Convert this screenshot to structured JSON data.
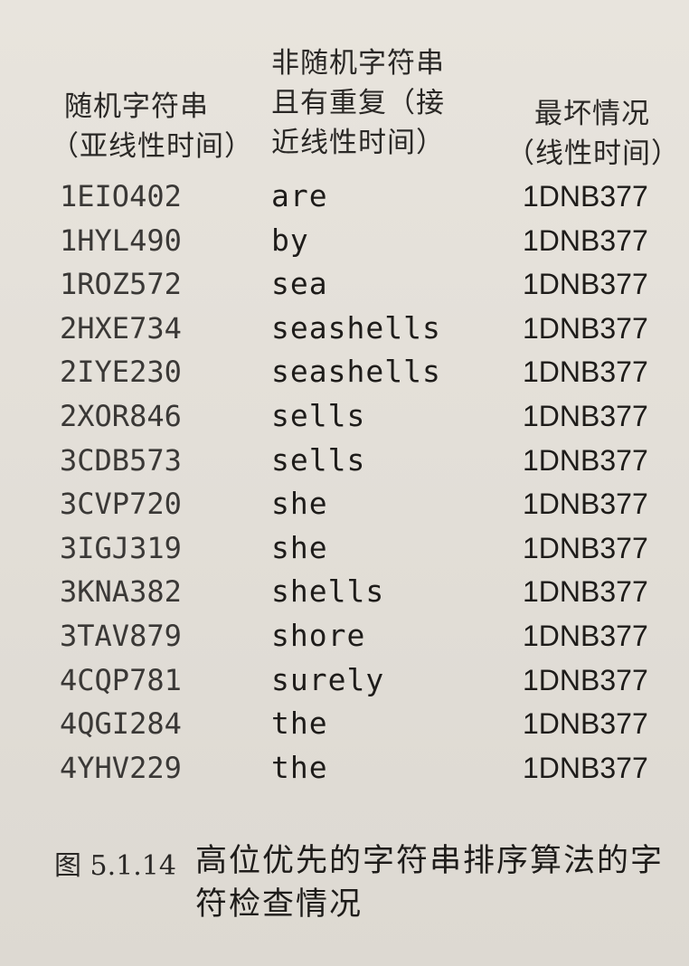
{
  "headers": {
    "col1": [
      "随机字符串",
      "（亚线性时间）"
    ],
    "col2": [
      "非随机字符串",
      "且有重复（接",
      "近线性时间）"
    ],
    "col3": [
      "最坏情况",
      "（线性时间）"
    ]
  },
  "rows": [
    {
      "random": "1EIO402",
      "nonrandom": "are",
      "worst": "1DNB377"
    },
    {
      "random": "1HYL490",
      "nonrandom": "by",
      "worst": "1DNB377"
    },
    {
      "random": "1ROZ572",
      "nonrandom": "sea",
      "worst": "1DNB377"
    },
    {
      "random": "2HXE734",
      "nonrandom": "seashells",
      "worst": "1DNB377"
    },
    {
      "random": "2IYE230",
      "nonrandom": "seashells",
      "worst": "1DNB377"
    },
    {
      "random": "2XOR846",
      "nonrandom": "sells",
      "worst": "1DNB377"
    },
    {
      "random": "3CDB573",
      "nonrandom": "sells",
      "worst": "1DNB377"
    },
    {
      "random": "3CVP720",
      "nonrandom": "she",
      "worst": "1DNB377"
    },
    {
      "random": "3IGJ319",
      "nonrandom": "she",
      "worst": "1DNB377"
    },
    {
      "random": "3KNA382",
      "nonrandom": "shells",
      "worst": "1DNB377"
    },
    {
      "random": "3TAV879",
      "nonrandom": "shore",
      "worst": "1DNB377"
    },
    {
      "random": "4CQP781",
      "nonrandom": "surely",
      "worst": "1DNB377"
    },
    {
      "random": "4QGI284",
      "nonrandom": "the",
      "worst": "1DNB377"
    },
    {
      "random": "4YHV229",
      "nonrandom": "the",
      "worst": "1DNB377"
    }
  ],
  "caption": {
    "label": "图 5.1.14",
    "text": "高位优先的字符串排序算法的字符检查情况"
  }
}
